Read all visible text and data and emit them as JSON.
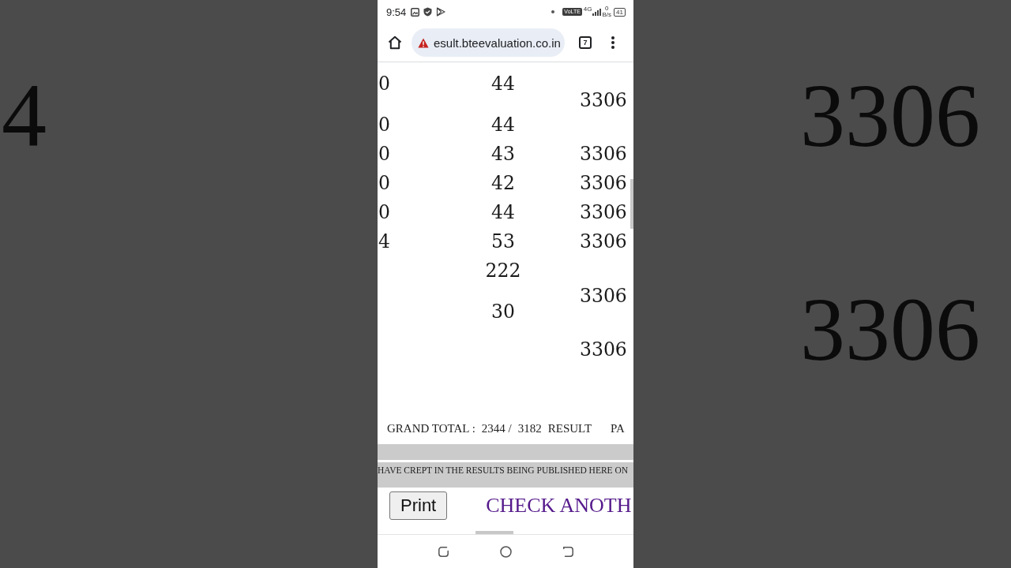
{
  "backdrop": {
    "left_texts": [
      "4"
    ],
    "right_texts": [
      "3306",
      "3306"
    ]
  },
  "status_bar": {
    "time": "9:54",
    "network_badge": "VoLTE",
    "network_type": "4G",
    "speed_value": "0",
    "speed_unit": "B/s",
    "battery": "41"
  },
  "browser": {
    "url": "esult.bteevaluation.co.in",
    "tab_count": "7"
  },
  "results": {
    "column_1": [
      "0",
      "0",
      "0",
      "0",
      "0",
      "4"
    ],
    "column_2": [
      "44",
      "44",
      "43",
      "42",
      "44",
      "53",
      "222",
      "30"
    ],
    "column_3": [
      "3306",
      "3306",
      "3306",
      "3306",
      "3306",
      "3306",
      "3306"
    ]
  },
  "grand_total": {
    "label": "GRAND TOTAL :",
    "obtained": "2344 /",
    "maximum": "3182",
    "result_label": "RESULT",
    "result_value": "PA"
  },
  "notice": "HAVE CREPT IN THE RESULTS BEING PUBLISHED HERE ON",
  "actions": {
    "print_button": "Print",
    "check_link": "CHECK ANOTH"
  }
}
